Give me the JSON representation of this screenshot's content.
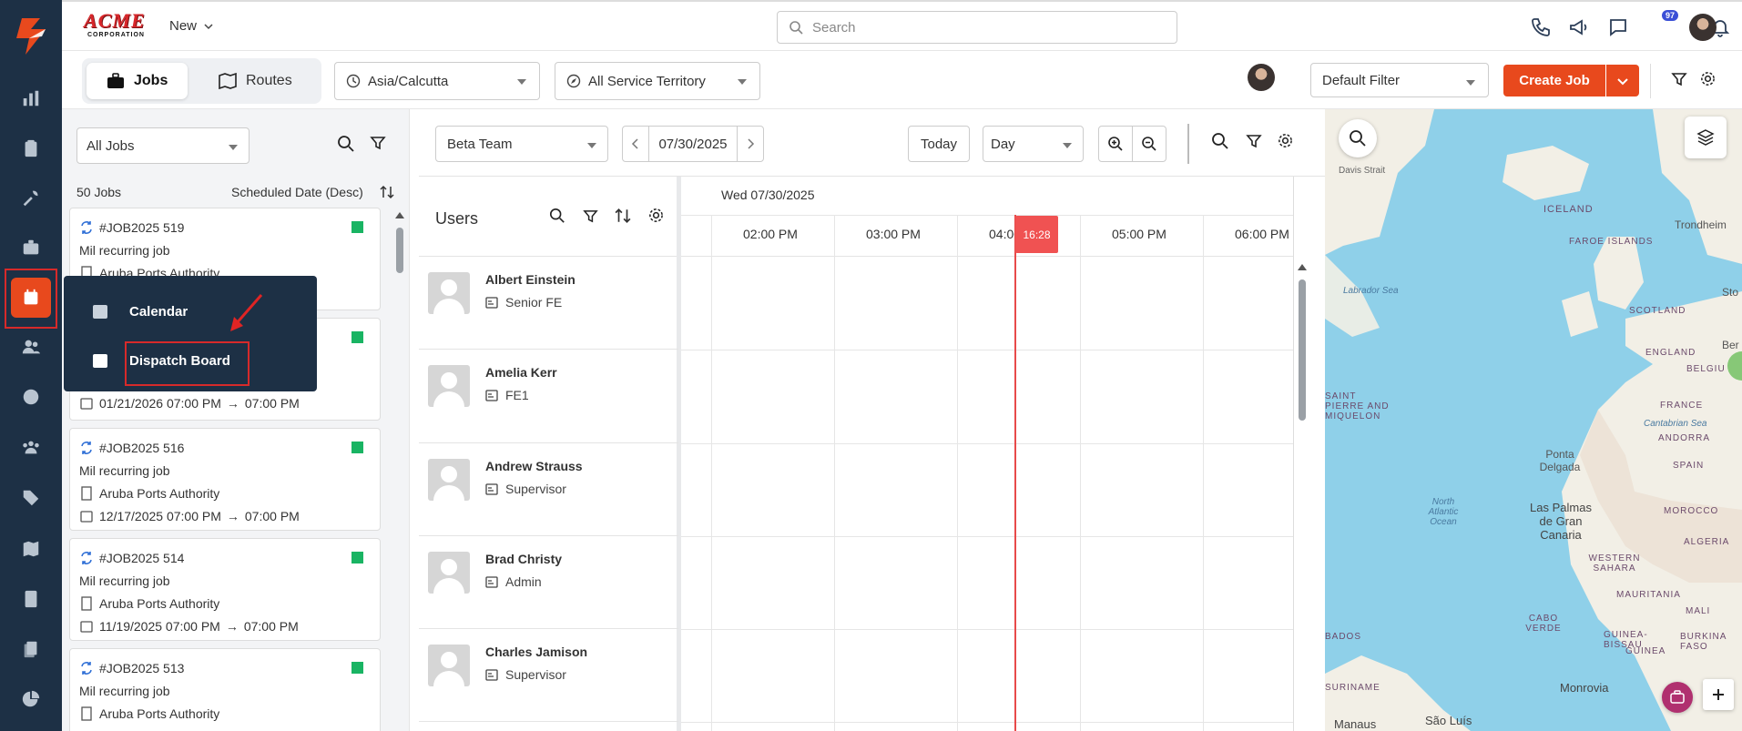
{
  "brand": {
    "name": "ACME",
    "sub": "CORPORATION"
  },
  "header": {
    "new_label": "New",
    "search_placeholder": "Search",
    "notification_count": "97"
  },
  "toolbar": {
    "tabs": [
      {
        "label": "Jobs"
      },
      {
        "label": "Routes"
      }
    ],
    "timezone": "Asia/Calcutta",
    "territory": "All Service Territory",
    "filter": "Default Filter",
    "create_job": "Create Job"
  },
  "jobs_panel": {
    "filter": "All Jobs",
    "count": "50 Jobs",
    "sort": "Scheduled Date (Desc)",
    "jobs": [
      {
        "id": "#JOB2025 519",
        "title": "Mil recurring job",
        "customer": "Aruba Ports Authority",
        "date": ""
      },
      {
        "id": "",
        "title": "",
        "customer": "",
        "date": "01/21/2026 07:00 PM",
        "end": "07:00 PM"
      },
      {
        "id": "#JOB2025 516",
        "title": "Mil recurring job",
        "customer": "Aruba Ports Authority",
        "date": "12/17/2025 07:00 PM",
        "end": "07:00 PM"
      },
      {
        "id": "#JOB2025 514",
        "title": "Mil recurring job",
        "customer": "Aruba Ports Authority",
        "date": "11/19/2025 07:00 PM",
        "end": "07:00 PM"
      },
      {
        "id": "#JOB2025 513",
        "title": "Mil recurring job",
        "customer": "Aruba Ports Authority",
        "date": ""
      }
    ]
  },
  "flyout": {
    "items": [
      {
        "label": "Calendar"
      },
      {
        "label": "Dispatch Board"
      }
    ]
  },
  "dispatch": {
    "team": "Beta Team",
    "date": "07/30/2025",
    "today": "Today",
    "view": "Day",
    "users_title": "Users",
    "day_label": "Wed 07/30/2025",
    "hours": [
      "02:00 PM",
      "03:00 PM",
      "04:00 PM",
      "05:00 PM",
      "06:00 PM"
    ],
    "now": "16:28",
    "users": [
      {
        "name": "Albert Einstein",
        "role": "Senior FE"
      },
      {
        "name": "Amelia Kerr",
        "role": "FE1"
      },
      {
        "name": "Andrew Strauss",
        "role": "Supervisor"
      },
      {
        "name": "Brad Christy",
        "role": "Admin"
      },
      {
        "name": "Charles Jamison",
        "role": "Supervisor"
      }
    ]
  },
  "map": {
    "labels": [
      "Davis Strait",
      "ICELAND",
      "FAROE ISLANDS",
      "Trondheim",
      "Labrador Sea",
      "SCOTLAND",
      "ENGLAND",
      "Ber",
      "BELGIU",
      "SAINT PIERRE AND MIQUELON",
      "FRANCE",
      "Cantabrian Sea",
      "ANDORRA",
      "Ponta Delgada",
      "SPAIN",
      "North Atlantic Ocean",
      "Las Palmas de Gran Canaria",
      "MOROCCO",
      "ALGERIA",
      "WESTERN SAHARA",
      "MAURITANIA",
      "MALI",
      "CABO VERDE",
      "GUINEA-BISSAU",
      "BURKINA FASO",
      "BADOS",
      "Monrovia",
      "SURINAME",
      "Manaus",
      "São Luís",
      "Sto",
      "GUINEA"
    ]
  }
}
